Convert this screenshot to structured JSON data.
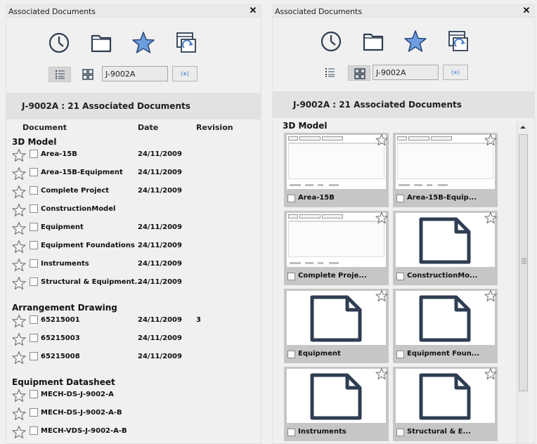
{
  "left_panel": {
    "title": "Associated Documents",
    "close_glyph": "✕",
    "search_value": "J-9002A",
    "header_text": "J-9002A : 21  Associated Documents",
    "columns": {
      "document": "Document",
      "date": "Date",
      "revision": "Revision"
    },
    "groups": [
      {
        "name": "3D Model",
        "rows": [
          {
            "name": "Area-15B",
            "date": "24/11/2009",
            "revision": ""
          },
          {
            "name": "Area-15B-Equipment",
            "date": "24/11/2009",
            "revision": ""
          },
          {
            "name": "Complete Project",
            "date": "24/11/2009",
            "revision": ""
          },
          {
            "name": "ConstructionModel",
            "date": "",
            "revision": ""
          },
          {
            "name": "Equipment",
            "date": "24/11/2009",
            "revision": ""
          },
          {
            "name": "Equipment Foundations",
            "date": "24/11/2009",
            "revision": ""
          },
          {
            "name": "Instruments",
            "date": "24/11/2009",
            "revision": ""
          },
          {
            "name": "Structural & Equipment...",
            "date": "24/11/2009",
            "revision": ""
          }
        ]
      },
      {
        "name": "Arrangement Drawing",
        "rows": [
          {
            "name": "65215001",
            "date": "24/11/2009",
            "revision": "3"
          },
          {
            "name": "65215003",
            "date": "24/11/2009",
            "revision": ""
          },
          {
            "name": "65215008",
            "date": "24/11/2009",
            "revision": ""
          }
        ]
      },
      {
        "name": "Equipment Datasheet",
        "rows": [
          {
            "name": "MECH-DS-J-9002-A",
            "date": "",
            "revision": ""
          },
          {
            "name": "MECH-DS-J-9002-A-B",
            "date": "",
            "revision": ""
          },
          {
            "name": "MECH-VDS-J-9002-A-B",
            "date": "",
            "revision": ""
          }
        ]
      }
    ]
  },
  "right_panel": {
    "title": "Associated Documents",
    "close_glyph": "✕",
    "search_value": "J-9002A",
    "header_text": "J-9002A : 21  Associated Documents",
    "group_name": "3D Model",
    "tiles": [
      {
        "name": "Area-15B",
        "thumb": "screenshot"
      },
      {
        "name": "Area-15B-Equip...",
        "thumb": "screenshot"
      },
      {
        "name": "Complete Proje...",
        "thumb": "screenshot"
      },
      {
        "name": "ConstructionMo...",
        "thumb": "document-icon"
      },
      {
        "name": "Equipment",
        "thumb": "document-icon"
      },
      {
        "name": "Equipment Foun...",
        "thumb": "document-icon"
      },
      {
        "name": "Instruments",
        "thumb": "document-icon"
      },
      {
        "name": "Structural & E...",
        "thumb": "document-icon"
      }
    ]
  },
  "toolbar_icons": [
    "clock-icon",
    "folder-icon",
    "star-icon",
    "linked-document-icon"
  ],
  "view_icons": [
    "list-view-icon",
    "grid-view-icon"
  ],
  "colors": {
    "star_fill": "#6d9ee0",
    "star_stroke": "#2d4a7a",
    "icon_dark": "#2f3d52",
    "header_band": "#e2e2e2",
    "tile_frame": "#c6c6c6"
  }
}
